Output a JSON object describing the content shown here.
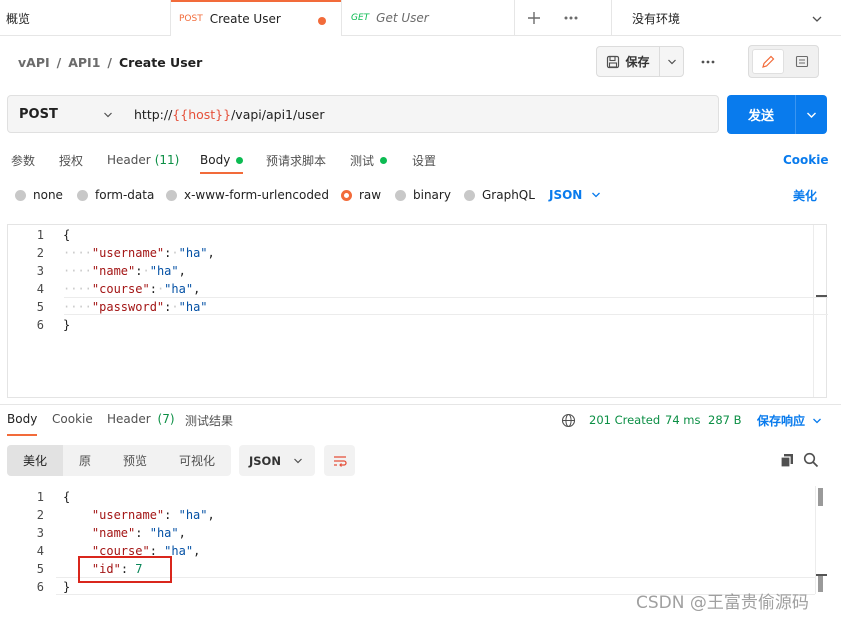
{
  "tabs": {
    "overview": "概览",
    "create_user": {
      "method": "POST",
      "name": "Create User"
    },
    "get_user": {
      "method": "GET",
      "name": "Get User"
    },
    "add_icon": "plus-icon",
    "more_icon": "more-icon"
  },
  "environment": {
    "label": "没有环境"
  },
  "breadcrumb": {
    "part1": "vAPI",
    "sep1": "/",
    "part2": "API1",
    "sep2": "/",
    "current": "Create User"
  },
  "toolbar": {
    "save_label": "保存"
  },
  "request": {
    "method": "POST",
    "url_prefix": "http://",
    "url_var": "{{host}}",
    "url_suffix": "/vapi/api1/user",
    "send_label": "发送"
  },
  "request_tabs": {
    "params": "参数",
    "auth": "授权",
    "headers": "Header",
    "headers_count": "(11)",
    "body": "Body",
    "prerequest": "预请求脚本",
    "tests": "测试",
    "settings": "设置",
    "cookie": "Cookie"
  },
  "body_types": {
    "none": "none",
    "form_data": "form-data",
    "urlencoded": "x-www-form-urlencoded",
    "raw": "raw",
    "binary": "binary",
    "graphql": "GraphQL",
    "format": "JSON",
    "beautify": "美化"
  },
  "request_body": {
    "line_numbers": [
      "1",
      "2",
      "3",
      "4",
      "5",
      "6"
    ],
    "open": "{",
    "close": "}",
    "lines": [
      {
        "key": "\"username\"",
        "value": "\"ha\"",
        "comma": ","
      },
      {
        "key": "\"name\"",
        "value": "\"ha\"",
        "comma": ","
      },
      {
        "key": "\"course\"",
        "value": "\"ha\"",
        "comma": ","
      },
      {
        "key": "\"password\"",
        "value": "\"ha\"",
        "comma": ""
      }
    ]
  },
  "response_tabs": {
    "body": "Body",
    "cookie": "Cookie",
    "headers": "Header",
    "headers_count": "(7)",
    "test_results": "测试结果"
  },
  "response_status": {
    "status": "201 Created",
    "time": "74 ms",
    "size": "287 B",
    "save_response": "保存响应"
  },
  "response_view": {
    "pretty": "美化",
    "raw": "原",
    "preview": "预览",
    "visualize": "可视化",
    "format": "JSON"
  },
  "response_body": {
    "line_numbers": [
      "1",
      "2",
      "3",
      "4",
      "5",
      "6"
    ],
    "open": "{",
    "close": "}",
    "lines": [
      {
        "key": "\"username\"",
        "value": "\"ha\"",
        "comma": ","
      },
      {
        "key": "\"name\"",
        "value": "\"ha\"",
        "comma": ","
      },
      {
        "key": "\"course\"",
        "value": "\"ha\"",
        "comma": ","
      },
      {
        "key": "\"id\"",
        "value": "7",
        "comma": ""
      }
    ]
  },
  "watermark": "CSDN @王富贵偷源码",
  "colors": {
    "accent": "#097bed",
    "post": "#f26b3a",
    "get": "#0cbb52",
    "status": "#0c8f45",
    "highlight": "#d9261c"
  }
}
